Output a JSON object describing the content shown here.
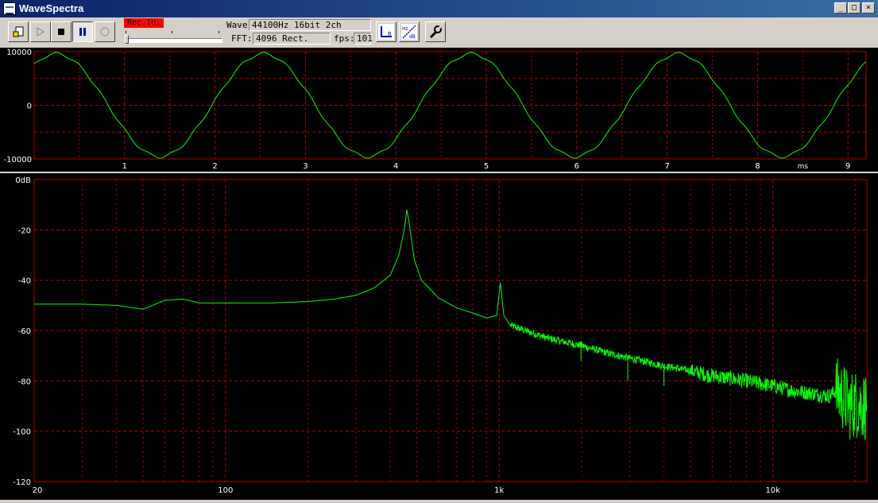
{
  "window": {
    "title": "WaveSpectra",
    "controls": [
      "_",
      "□",
      "×"
    ]
  },
  "toolbar": {
    "buttons": [
      {
        "name": "open-button",
        "icon": "file-open-icon"
      },
      {
        "name": "play-button",
        "icon": "play-icon"
      },
      {
        "name": "stop-button",
        "icon": "stop-icon"
      },
      {
        "name": "pause-button",
        "icon": "pause-icon",
        "pressed": true
      },
      {
        "name": "record-button",
        "icon": "record-icon"
      }
    ],
    "rec_indicator": "Rec.In.",
    "input_level": 0.0,
    "wave_label": "Wave:",
    "wave_value": "44100Hz 16bit 2ch",
    "fft_label": "FFT:",
    "fft_value": "4096 Rect.",
    "fps_label": "fps:",
    "fps_value": "101",
    "tool_buttons": [
      {
        "name": "channel-lr-button",
        "icon": "lr-channel-icon"
      },
      {
        "name": "hz-db-button",
        "icon": "hz-db-scale-icon"
      },
      {
        "name": "settings-button",
        "icon": "wrench-icon"
      }
    ]
  },
  "colors": {
    "trace": "#00ff00",
    "grid": "#b00000",
    "tick_label": "#ffffff",
    "rec_indicator": "#ff0000"
  },
  "chart_data": [
    {
      "type": "line",
      "title": "",
      "xlabel": "ms",
      "ylabel": "",
      "x_ticks": [
        "1",
        "2",
        "3",
        "4",
        "5",
        "6",
        "7",
        "8",
        "9"
      ],
      "y_ticks": [
        "10000",
        "0",
        "-10000"
      ],
      "xlim": [
        0,
        9.2
      ],
      "ylim": [
        -10000,
        10000
      ],
      "grid": true,
      "series": [
        {
          "frequency_hz": 436,
          "amplitude": 9600,
          "x_start": 0,
          "x_end": 9.2
        }
      ]
    },
    {
      "type": "line",
      "title": "",
      "xlabel": "",
      "ylabel": "",
      "x_scale": "log",
      "x_ticks": [
        "20",
        "100",
        "1k",
        "10k"
      ],
      "y_ticks": [
        "0dB",
        "-20",
        "-40",
        "-60",
        "-80",
        "-100",
        "-120"
      ],
      "xlim": [
        20,
        22050
      ],
      "ylim": [
        -120,
        0
      ],
      "grid": true,
      "series": [
        {
          "points": [
            [
              20,
              -49.5
            ],
            [
              30,
              -49.5
            ],
            [
              40,
              -50
            ],
            [
              50,
              -51.5
            ],
            [
              60,
              -48
            ],
            [
              70,
              -47.5
            ],
            [
              80,
              -49
            ],
            [
              100,
              -49
            ],
            [
              150,
              -49
            ],
            [
              200,
              -48.5
            ],
            [
              250,
              -47.5
            ],
            [
              300,
              -46
            ],
            [
              350,
              -43
            ],
            [
              400,
              -38
            ],
            [
              430,
              -30
            ],
            [
              450,
              -20
            ],
            [
              460,
              -12
            ],
            [
              470,
              -18
            ],
            [
              490,
              -32
            ],
            [
              520,
              -40
            ],
            [
              600,
              -47
            ],
            [
              700,
              -51
            ],
            [
              800,
              -53
            ],
            [
              900,
              -55
            ],
            [
              980,
              -54
            ],
            [
              1010,
              -41
            ],
            [
              1040,
              -54
            ],
            [
              1100,
              -58
            ],
            [
              1500,
              -63
            ],
            [
              2000,
              -66
            ],
            [
              2500,
              -69
            ],
            [
              3000,
              -71
            ],
            [
              4000,
              -74
            ],
            [
              5000,
              -76
            ],
            [
              6000,
              -78
            ],
            [
              7000,
              -79
            ],
            [
              8000,
              -80
            ],
            [
              10000,
              -82
            ],
            [
              12000,
              -84
            ],
            [
              14000,
              -85
            ],
            [
              16000,
              -86
            ],
            [
              17000,
              -84
            ],
            [
              18000,
              -86
            ],
            [
              19000,
              -90
            ],
            [
              20000,
              -89
            ],
            [
              22050,
              -90
            ]
          ]
        }
      ],
      "annotations": [
        {
          "x": 1990,
          "peak": -64
        },
        {
          "x": 2950,
          "peak": -72
        },
        {
          "x": 4000,
          "peak": -74
        }
      ]
    }
  ]
}
